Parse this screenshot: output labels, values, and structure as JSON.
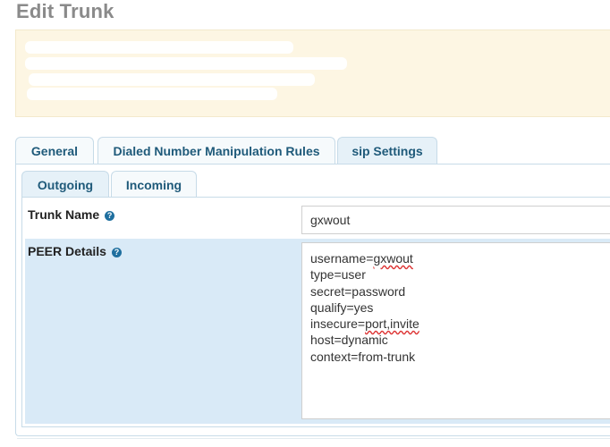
{
  "page": {
    "title": "Edit Trunk"
  },
  "tabs": [
    {
      "label": "General"
    },
    {
      "label": "Dialed Number Manipulation Rules"
    },
    {
      "label": "sip Settings"
    }
  ],
  "subtabs": [
    {
      "label": "Outgoing"
    },
    {
      "label": "Incoming"
    }
  ],
  "form": {
    "trunk_name": {
      "label": "Trunk Name",
      "value": "gxwout"
    },
    "peer_details": {
      "label": "PEER Details",
      "lines": [
        {
          "key": "username=",
          "val": "gxwout"
        },
        {
          "key": "type=user",
          "val": ""
        },
        {
          "key": "secret=password",
          "val": ""
        },
        {
          "key": "qualify=yes",
          "val": ""
        },
        {
          "key": "insecure=",
          "val": "port,invite"
        },
        {
          "key": "host=dynamic",
          "val": ""
        },
        {
          "key": "context=from-trunk",
          "val": ""
        }
      ]
    }
  },
  "icons": {
    "help": "question-circle-icon"
  },
  "colors": {
    "tab_text": "#1f5a7a",
    "highlight_row": "#d9eaf7",
    "notice_bg": "#fdf6e3"
  }
}
